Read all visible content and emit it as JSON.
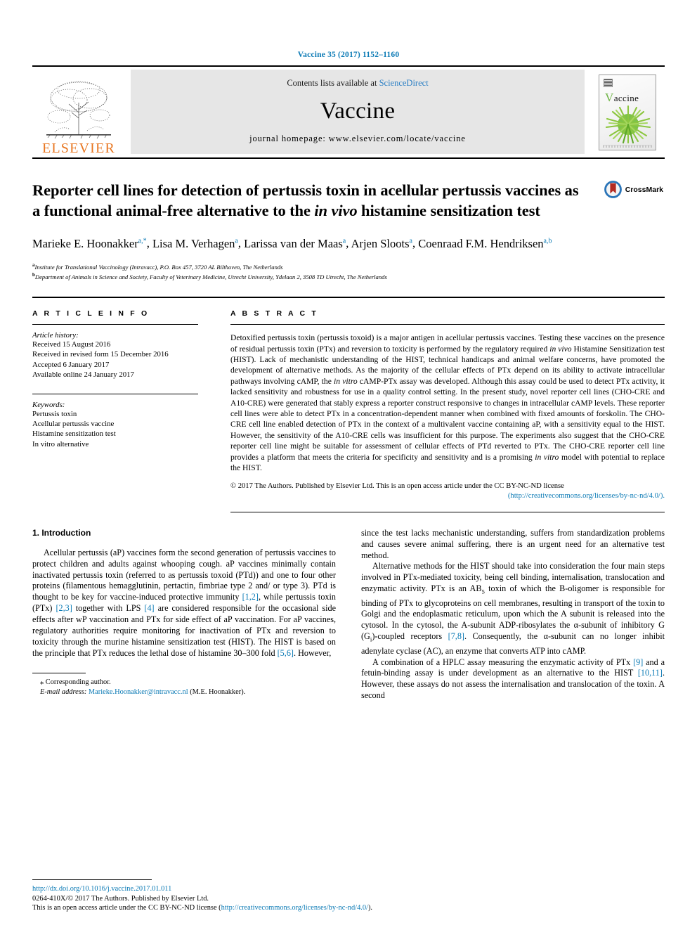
{
  "running_head": "Vaccine 35 (2017) 1152–1160",
  "masthead": {
    "publisher_name": "ELSEVIER",
    "contents_prefix": "Contents lists available at ",
    "contents_link": "ScienceDirect",
    "journal_title": "Vaccine",
    "homepage_line": "journal homepage: www.elsevier.com/locate/vaccine",
    "cover_title": "Vaccine",
    "cover_title_initial": "V"
  },
  "article": {
    "title_part1": "Reporter cell lines for detection of pertussis toxin in acellular pertussis vaccines as a functional animal-free alternative to the ",
    "title_italic": "in vivo",
    "title_part2": " histamine sensitization test",
    "crossmark_label": "CrossMark",
    "authors": [
      {
        "name": "Marieke E. Hoonakker",
        "marks": "a,*"
      },
      {
        "name": "Lisa M. Verhagen",
        "marks": "a"
      },
      {
        "name": "Larissa van der Maas",
        "marks": "a"
      },
      {
        "name": "Arjen Sloots",
        "marks": "a"
      },
      {
        "name": "Coenraad F.M. Hendriksen",
        "marks": "a,b"
      }
    ],
    "affiliations": [
      {
        "mark": "a",
        "text": "Institute for Translational Vaccinology (Intravacc), P.O. Box 457, 3720 AL Bilthoven, The Netherlands"
      },
      {
        "mark": "b",
        "text": "Department of Animals in Science and Society, Faculty of Veterinary Medicine, Utrecht University, Ydelaan 2, 3508 TD Utrecht, The Netherlands"
      }
    ]
  },
  "article_info": {
    "heading": "A R T I C L E   I N F O",
    "history_label": "Article history:",
    "history": [
      "Received 15 August 2016",
      "Received in revised form 15 December 2016",
      "Accepted 6 January 2017",
      "Available online 24 January 2017"
    ],
    "keywords_label": "Keywords:",
    "keywords": [
      "Pertussis toxin",
      "Acellular pertussis vaccine",
      "Histamine sensitization test",
      "In vitro alternative"
    ]
  },
  "abstract": {
    "heading": "A B S T R A C T",
    "p1_a": "Detoxified pertussis toxin (pertussis toxoid) is a major antigen in acellular pertussis vaccines. Testing these vaccines on the presence of residual pertussis toxin (PTx) and reversion to toxicity is performed by the regulatory required ",
    "p1_i1": "in vivo",
    "p1_b": " Histamine Sensitization test (HIST). Lack of mechanistic understanding of the HIST, technical handicaps and animal welfare concerns, have promoted the development of alternative methods. As the majority of the cellular effects of PTx depend on its ability to activate intracellular pathways involving cAMP, the ",
    "p1_i2": "in vitro",
    "p1_c": " cAMP-PTx assay was developed. Although this assay could be used to detect PTx activity, it lacked sensitivity and robustness for use in a quality control setting. In the present study, novel reporter cell lines (CHO-CRE and A10-CRE) were generated that stably express a reporter construct responsive to changes in intracellular cAMP levels. These reporter cell lines were able to detect PTx in a concentration-dependent manner when combined with fixed amounts of forskolin. The CHO-CRE cell line enabled detection of PTx in the context of a multivalent vaccine containing aP, with a sensitivity equal to the HIST. However, the sensitivity of the A10-CRE cells was insufficient for this purpose. The experiments also suggest that the CHO-CRE reporter cell line might be suitable for assessment of cellular effects of PTd reverted to PTx. The CHO-CRE reporter cell line provides a platform that meets the criteria for specificity and sensitivity and is a promising ",
    "p1_i3": "in vitro",
    "p1_d": " model with potential to replace the HIST.",
    "copyright": "© 2017 The Authors. Published by Elsevier Ltd. This is an open access article under the CC BY-NC-ND license",
    "license_url": "(http://creativecommons.org/licenses/by-nc-nd/4.0/)."
  },
  "introduction": {
    "heading": "1. Introduction",
    "left_p1_a": "Acellular pertussis (aP) vaccines form the second generation of pertussis vaccines to protect children and adults against whooping cough. aP vaccines minimally contain inactivated pertussis toxin (referred to as pertussis toxoid (PTd)) and one to four other proteins (filamentous hemagglutinin, pertactin, fimbriae type 2 and/ or type 3). PTd is thought to be key for vaccine-induced protective immunity ",
    "left_ref1": "[1,2]",
    "left_p1_b": ", while pertussis toxin (PTx) ",
    "left_ref2": "[2,3]",
    "left_p1_c": " together with LPS ",
    "left_ref3": "[4]",
    "left_p1_d": " are considered responsible for the occasional side effects after wP vaccination and PTx for side effect of aP vaccination. For aP vaccines, regulatory authorities require monitoring for inactivation of PTx and reversion to toxicity through the murine histamine sensitization test (HIST). The HIST is based on the principle that PTx reduces the lethal dose of histamine 30–300 fold ",
    "left_ref4": "[5,6]",
    "left_p1_e": ". However,",
    "right_p1": "since the test lacks mechanistic understanding, suffers from standardization problems and causes severe animal suffering, there is an urgent need for an alternative test method.",
    "right_p2_a": "Alternative methods for the HIST should take into consideration the four main steps involved in PTx-mediated toxicity, being cell binding, internalisation, translocation and enzymatic activity. PTx is an AB",
    "right_p2_sub1": "5",
    "right_p2_b": " toxin of which the B-oligomer is responsible for binding of PTx to glycoproteins on cell membranes, resulting in transport of the toxin to Golgi and the endoplasmatic reticulum, upon which the A subunit is released into the cytosol. In the cytosol, the A-subunit ADP-ribosylates the α-subunit of inhibitory G (G",
    "right_p2_sub2": "i",
    "right_p2_c": ")-coupled receptors ",
    "right_ref1": "[7,8]",
    "right_p2_d": ". Consequently, the α-subunit can no longer inhibit adenylate cyclase (AC), an enzyme that converts ATP into cAMP.",
    "right_p3_a": "A combination of a HPLC assay measuring the enzymatic activity of PTx ",
    "right_ref2": "[9]",
    "right_p3_b": " and a fetuin-binding assay is under development as an alternative to the HIST ",
    "right_ref3": "[10,11]",
    "right_p3_c": ". However, these assays do not assess the internalisation and translocation of the toxin. A second"
  },
  "footnote": {
    "corresponding_marker": "⁎",
    "corresponding_text": " Corresponding author.",
    "email_label": "E-mail address:",
    "email": "Marieke.Hoonakker@intravacc.nl",
    "email_suffix": " (M.E. Hoonakker)."
  },
  "page_footer": {
    "doi": "http://dx.doi.org/10.1016/j.vaccine.2017.01.011",
    "issn_line": "0264-410X/© 2017 The Authors. Published by Elsevier Ltd.",
    "license_prefix": "This is an open access article under the CC BY-NC-ND license (",
    "license_url": "http://creativecommons.org/licenses/by-nc-nd/4.0/",
    "license_suffix": ")."
  },
  "colors": {
    "link_blue": "#0b7ab5",
    "elsevier_orange": "#E87722",
    "band_grey": "#e6e6e6",
    "crossmark_blue": "#2a74b8",
    "crossmark_red": "#b32a22"
  }
}
